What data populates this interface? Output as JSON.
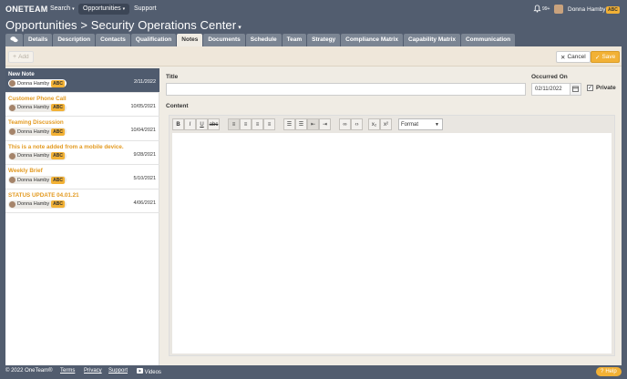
{
  "brand": {
    "logo": "oneteam"
  },
  "nav": {
    "search": "Search",
    "opportunities": "Opportunities",
    "support": "Support",
    "notification_count": "99+",
    "user_name": "Donna Hamby",
    "user_badge": "ABC"
  },
  "page": {
    "section": "Opportunities",
    "separator": ">",
    "record": "Security Operations Center"
  },
  "tabs": [
    "Details",
    "Description",
    "Contacts",
    "Qualification",
    "Notes",
    "Documents",
    "Schedule",
    "Team",
    "Strategy",
    "Compliance Matrix",
    "Capability Matrix",
    "Communication"
  ],
  "active_tab": "Notes",
  "toolbar": {
    "add_label": "Add",
    "cancel_label": "Cancel",
    "save_label": "Save"
  },
  "notes": [
    {
      "title": "New Note",
      "author": "Donna Hamby",
      "badge": "ABC",
      "date": "2/11/2022",
      "selected": true
    },
    {
      "title": "Customer Phone Call",
      "author": "Donna Hamby",
      "badge": "ABC",
      "date": "10/05/2021",
      "selected": false
    },
    {
      "title": "Teaming Discussion",
      "author": "Donna Hamby",
      "badge": "ABC",
      "date": "10/04/2021",
      "selected": false
    },
    {
      "title": "This is a note added from a mobile device.",
      "author": "Donna Hamby",
      "badge": "ABC",
      "date": "9/28/2021",
      "selected": false
    },
    {
      "title": "Weekly Brief",
      "author": "Donna Hamby",
      "badge": "ABC",
      "date": "5/10/2021",
      "selected": false
    },
    {
      "title": "STATUS UPDATE 04.01.21",
      "author": "Donna Hamby",
      "badge": "ABC",
      "date": "4/06/2021",
      "selected": false
    }
  ],
  "form": {
    "title_label": "Title",
    "title_value": "",
    "occurred_label": "Occurred On",
    "occurred_value": "02/11/2022",
    "private_label": "Private",
    "private_checked": true,
    "content_label": "Content",
    "format_label": "Format"
  },
  "footer": {
    "copyright": "© 2022 OneTeam®",
    "terms": "Terms",
    "privacy": "Privacy",
    "support": "Support",
    "videos": "Videos",
    "help": "Help"
  },
  "colors": {
    "nav_bg": "#525d6f",
    "accent": "#f2b135",
    "note_title": "#e39a21",
    "selected_bg": "#4f5b6e"
  }
}
